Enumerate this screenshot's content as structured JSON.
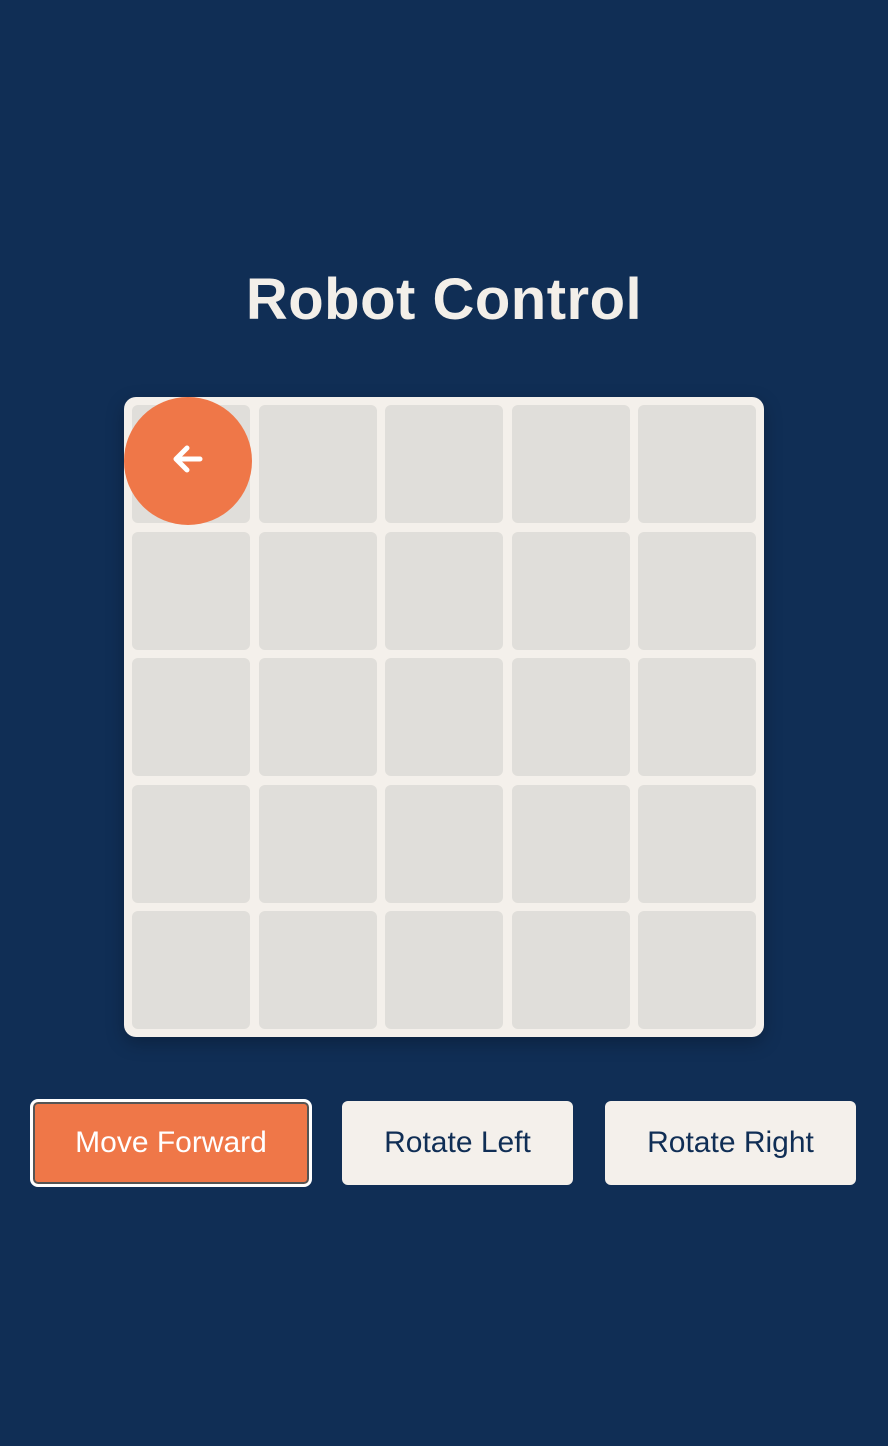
{
  "page": {
    "title": "Robot Control"
  },
  "grid": {
    "rows": 5,
    "columns": 5
  },
  "robot": {
    "row": 1,
    "column": 1,
    "facing": "left",
    "icon": "arrow-left-icon"
  },
  "controls": {
    "move_forward": "Move Forward",
    "rotate_left": "Rotate Left",
    "rotate_right": "Rotate Right"
  },
  "colors": {
    "background": "#102e55",
    "accent": "#ef7748",
    "board": "#f4f0eb",
    "cell": "#e0deda"
  }
}
